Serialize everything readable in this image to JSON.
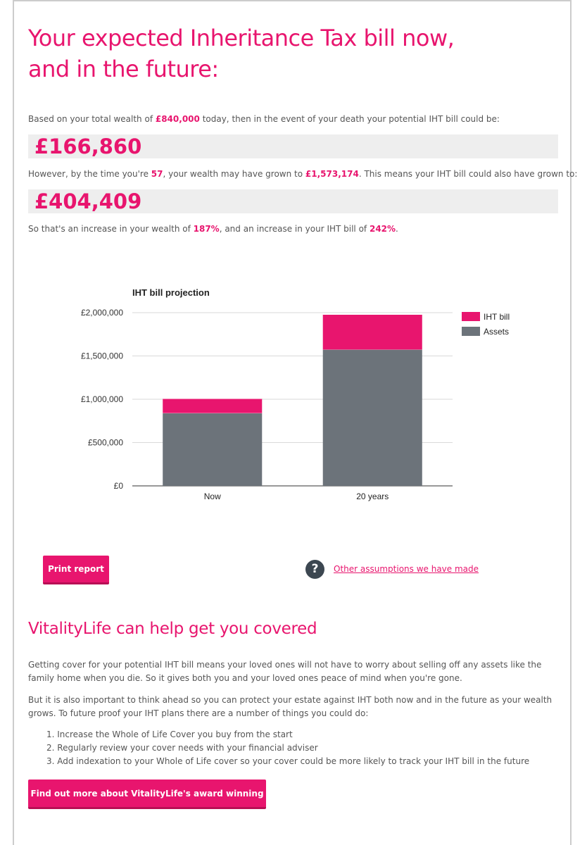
{
  "headline": {
    "line1": "Your expected Inheritance Tax bill now,",
    "line2": "and in the future:"
  },
  "summary": {
    "p1_a": "Based on your total wealth of ",
    "wealth_now": "£840,000",
    "p1_b": " today, then in the event of your death your potential IHT bill could be:",
    "iht_now": "£166,860",
    "p2_a": "However, by the time you're ",
    "age": "57",
    "p2_b": ", your wealth may have grown to ",
    "wealth_future": "£1,573,174",
    "p2_c": ". This means your IHT bill could also have grown to:",
    "iht_future": "£404,409",
    "p3_a": "So that's an increase in your wealth of ",
    "wealth_increase": "187%",
    "p3_b": ", and an increase in your IHT bill of ",
    "iht_increase": "242%",
    "p3_c": "."
  },
  "chart_data": {
    "type": "bar",
    "stacked": true,
    "title": "IHT bill projection",
    "categories": [
      "Now",
      "20 years"
    ],
    "series": [
      {
        "name": "Assets",
        "values": [
          840000,
          1573174
        ],
        "color": "#6c737a"
      },
      {
        "name": "IHT bill",
        "values": [
          166860,
          404409
        ],
        "color": "#e8156e"
      }
    ],
    "yticks": [
      "£0",
      "£500,000",
      "£1,000,000",
      "£1,500,000",
      "£2,000,000"
    ],
    "ylim": [
      0,
      2000000
    ],
    "grid": true,
    "legend_position": "right"
  },
  "actions": {
    "print_label": "Print report",
    "assumptions_link": "Other assumptions we have made",
    "help_glyph": "?",
    "cta_label": "Find out more about VitalityLife's award winning cover"
  },
  "vitality": {
    "heading": "VitalityLife can help get you covered",
    "para1": "Getting cover for your potential IHT bill means your loved ones will not have to worry about selling off any assets like the family home when you die. So it gives both you and your loved ones peace of mind when you're gone.",
    "para2": "But it is also important to think ahead so you can protect your estate against IHT both now and in the future as your wealth grows. To future proof your IHT plans there are a number of things you could do:",
    "steps": [
      "1. Increase the Whole of Life Cover you buy from the start",
      "2. Regularly review your cover needs with your financial adviser",
      "3. Add indexation to your Whole of Life cover so your cover could be more likely to track your IHT bill in the future"
    ]
  },
  "colors": {
    "accent": "#e8156e",
    "assets": "#6c737a",
    "panel": "#eeeeee"
  },
  "icons": {
    "help": "question-circle-icon"
  }
}
